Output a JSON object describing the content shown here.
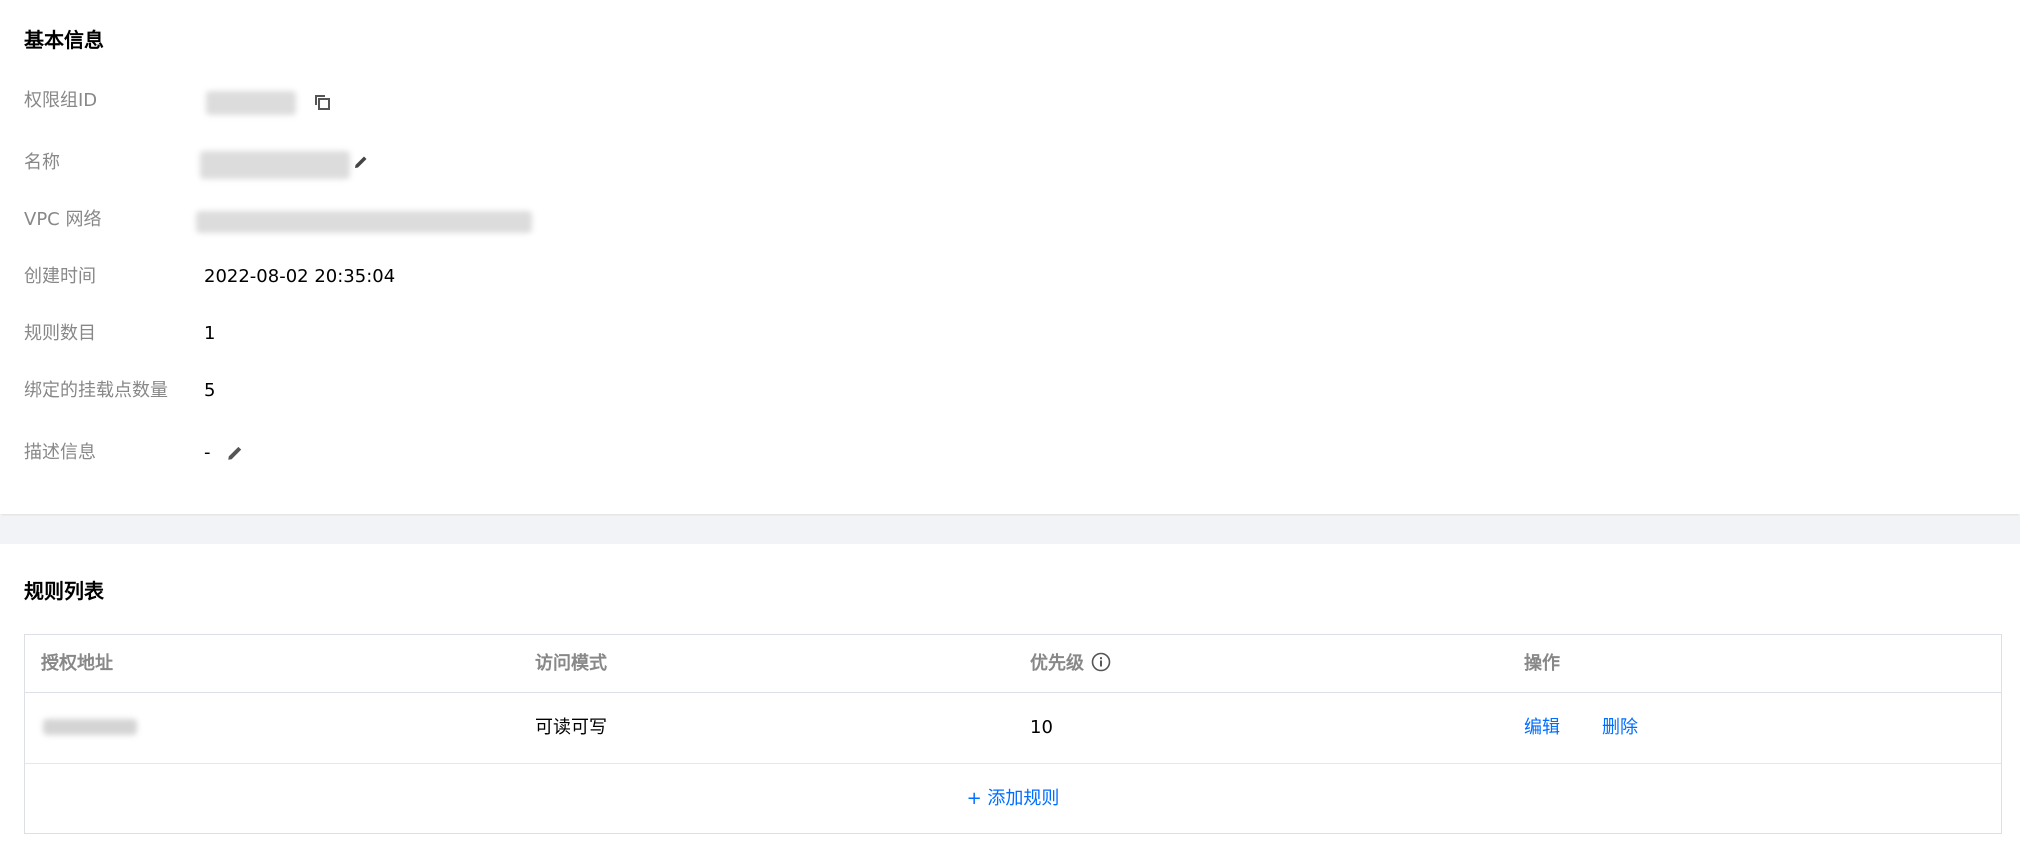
{
  "basic_info": {
    "title": "基本信息",
    "fields": {
      "group_id": {
        "label": "权限组ID"
      },
      "name": {
        "label": "名称"
      },
      "vpc": {
        "label": "VPC 网络"
      },
      "created_at": {
        "label": "创建时间",
        "value": "2022-08-02 20:35:04"
      },
      "rule_count": {
        "label": "规则数目",
        "value": "1"
      },
      "mount_count": {
        "label": "绑定的挂载点数量",
        "value": "5"
      },
      "description": {
        "label": "描述信息",
        "value": "-"
      }
    }
  },
  "rules": {
    "title": "规则列表",
    "columns": {
      "address": "授权地址",
      "mode": "访问模式",
      "priority": "优先级",
      "actions": "操作"
    },
    "rows": [
      {
        "mode": "可读可写",
        "priority": "10",
        "edit_label": "编辑",
        "delete_label": "删除"
      }
    ],
    "add_label": "+ 添加规则"
  },
  "colors": {
    "link": "#006eff",
    "label": "#888888",
    "gap": "#f2f3f6",
    "border": "#dcdfe5"
  },
  "icons": [
    "copy-icon",
    "edit-icon",
    "info-icon"
  ]
}
